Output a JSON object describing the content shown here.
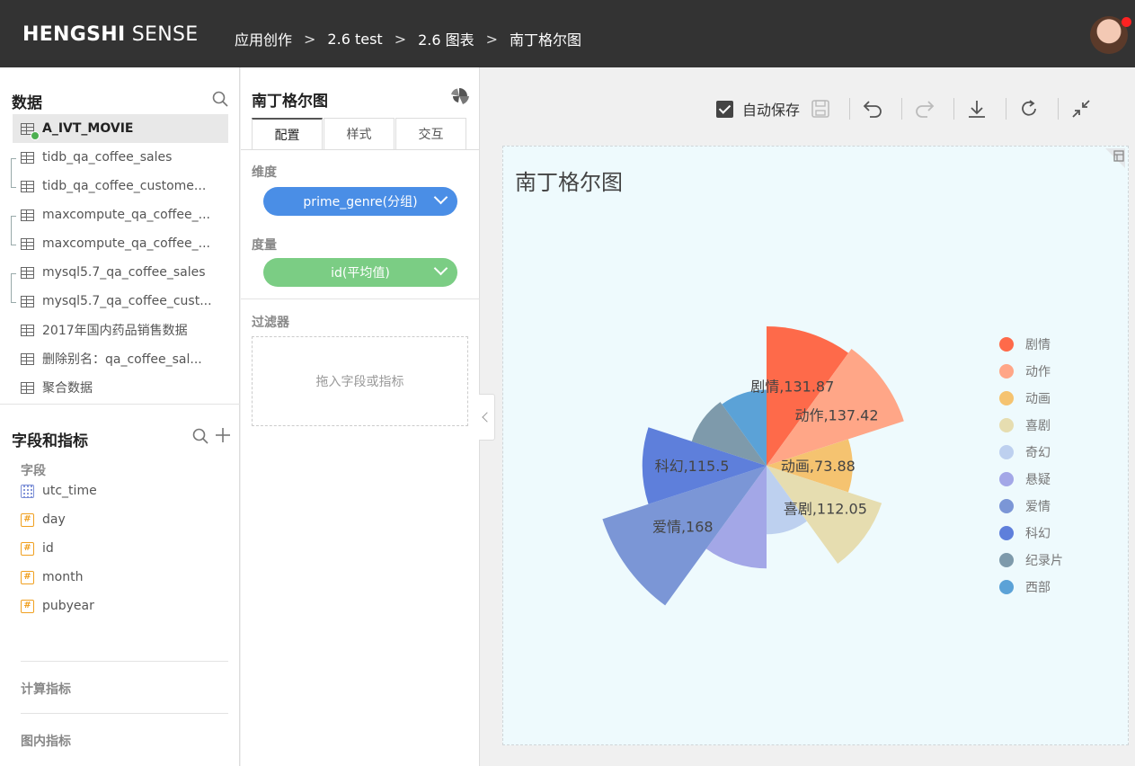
{
  "header": {
    "brand_bold": "HENGSHI",
    "brand_rest": " SENSE",
    "breadcrumb": [
      "应用创作",
      "2.6 test",
      "2.6 图表",
      "南丁格尔图"
    ],
    "separator": ">"
  },
  "data_panel": {
    "title": "数据",
    "datasets": [
      {
        "label": "A_IVT_MOVIE",
        "active": true
      },
      {
        "label": "tidb_qa_coffee_sales"
      },
      {
        "label": "tidb_qa_coffee_custome..."
      },
      {
        "label": "maxcompute_qa_coffee_..."
      },
      {
        "label": "maxcompute_qa_coffee_..."
      },
      {
        "label": "mysql5.7_qa_coffee_sales"
      },
      {
        "label": "mysql5.7_qa_coffee_cust..."
      },
      {
        "label": "2017年国内药品销售数据"
      },
      {
        "label": "删除别名：qa_coffee_sal..."
      },
      {
        "label": "聚合数据"
      }
    ]
  },
  "fields_panel": {
    "title": "字段和指标",
    "fields_label": "字段",
    "fields": [
      {
        "label": "utc_time",
        "type": "date"
      },
      {
        "label": "day",
        "type": "number"
      },
      {
        "label": "id",
        "type": "number"
      },
      {
        "label": "month",
        "type": "number"
      },
      {
        "label": "pubyear",
        "type": "number"
      }
    ],
    "calc_label": "计算指标",
    "inchart_label": "图内指标"
  },
  "config": {
    "title": "南丁格尔图",
    "tabs": [
      "配置",
      "样式",
      "交互"
    ],
    "dimension_label": "维度",
    "dimension_value": "prime_genre(分组)",
    "measure_label": "度量",
    "measure_value": "id(平均值)",
    "filter_label": "过滤器",
    "filter_placeholder": "拖入字段或指标"
  },
  "toolbar": {
    "autosave_label": "自动保存",
    "autosave_checked": true
  },
  "chart_data": {
    "type": "pie",
    "variant": "nightingale-rose",
    "title": "南丁格尔图",
    "legend_position": "right",
    "categories": [
      "剧情",
      "动作",
      "动画",
      "喜剧",
      "奇幻",
      "悬疑",
      "爱情",
      "科幻",
      "纪录片",
      "西部"
    ],
    "values": [
      131.87,
      137.42,
      73.88,
      112.05,
      55,
      92,
      168,
      115.5,
      66,
      63
    ],
    "data_labels": [
      "剧情,131.87",
      "动作,137.42",
      "动画,73.88",
      "喜剧,112.05",
      "",
      "",
      "爱情,168",
      "科幻,115.5",
      "",
      ""
    ],
    "colors": [
      "#fe6a4a",
      "#ffa687",
      "#f5c370",
      "#e6ddb0",
      "#bdd0ef",
      "#a3a7e7",
      "#7b96d6",
      "#5e7fdb",
      "#7e9aab",
      "#5ba2d7"
    ]
  }
}
